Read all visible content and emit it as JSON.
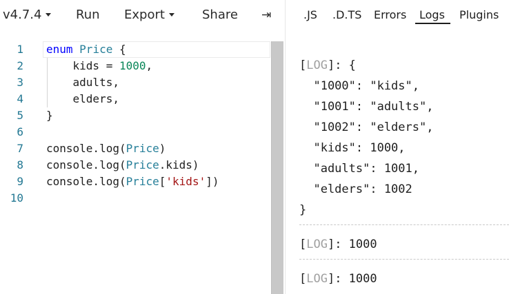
{
  "toolbar": {
    "version": "v4.7.4",
    "run": "Run",
    "export": "Export",
    "share": "Share",
    "expand_icon": "⇥"
  },
  "editor": {
    "line_numbers": [
      "1",
      "2",
      "3",
      "4",
      "5",
      "6",
      "7",
      "8",
      "9",
      "10"
    ],
    "lines": [
      [
        {
          "t": "enum",
          "c": "kw"
        },
        {
          "t": " ",
          "c": ""
        },
        {
          "t": "Price",
          "c": "ty"
        },
        {
          "t": " {",
          "c": ""
        }
      ],
      [
        {
          "t": "    kids = ",
          "c": ""
        },
        {
          "t": "1000",
          "c": "num"
        },
        {
          "t": ",",
          "c": ""
        }
      ],
      [
        {
          "t": "    adults,",
          "c": ""
        }
      ],
      [
        {
          "t": "    elders,",
          "c": ""
        }
      ],
      [
        {
          "t": "}",
          "c": ""
        }
      ],
      [],
      [
        {
          "t": "console.log(",
          "c": ""
        },
        {
          "t": "Price",
          "c": "ty"
        },
        {
          "t": ")",
          "c": ""
        }
      ],
      [
        {
          "t": "console.log(",
          "c": ""
        },
        {
          "t": "Price",
          "c": "ty"
        },
        {
          "t": ".kids)",
          "c": ""
        }
      ],
      [
        {
          "t": "console.log(",
          "c": ""
        },
        {
          "t": "Price",
          "c": "ty"
        },
        {
          "t": "[",
          "c": ""
        },
        {
          "t": "'kids'",
          "c": "str"
        },
        {
          "t": "])",
          "c": ""
        }
      ],
      []
    ]
  },
  "tabs": {
    "js": ".JS",
    "dts": ".D.TS",
    "errors": "Errors",
    "logs": "Logs",
    "plugins": "Plugins",
    "active": "Logs"
  },
  "logs": {
    "entries": [
      {
        "tag": "LOG",
        "lines": [
          "{",
          "  \"1000\": \"kids\",",
          "  \"1001\": \"adults\",",
          "  \"1002\": \"elders\",",
          "  \"kids\": 1000,",
          "  \"adults\": 1001,",
          "  \"elders\": 1002",
          "}"
        ]
      },
      {
        "tag": "LOG",
        "lines": [
          "1000"
        ]
      },
      {
        "tag": "LOG",
        "lines": [
          "1000"
        ]
      }
    ]
  }
}
